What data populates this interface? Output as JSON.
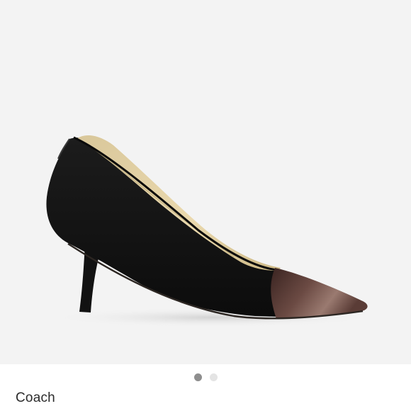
{
  "product": {
    "brand": "Coach",
    "image_icon": "shoe-photo",
    "image_background": "#f3f3f3"
  },
  "carousel": {
    "image_count": 2,
    "active_index": 0,
    "active_color": "#8e8e8e",
    "inactive_color": "#e4e4e4"
  }
}
